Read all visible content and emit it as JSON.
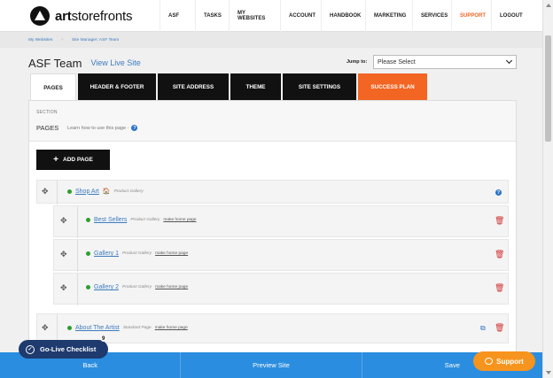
{
  "nav": {
    "brand_bold": "art",
    "brand_light": "storefronts",
    "items": [
      {
        "label": "ASF"
      },
      {
        "label": "TASKS"
      },
      {
        "label": "MY WEBSITES"
      },
      {
        "label": "ACCOUNT"
      },
      {
        "label": "HANDBOOK"
      },
      {
        "label": "MARKETING"
      },
      {
        "label": "SERVICES"
      },
      {
        "label": "SUPPORT"
      },
      {
        "label": "LOGOUT"
      }
    ]
  },
  "breadcrumb": {
    "items": [
      "My Websites",
      "Site Manager: ASF Team"
    ],
    "separator": "›"
  },
  "header": {
    "title": "ASF Team",
    "view_live": "View Live Site",
    "jump_label": "Jump to:",
    "jump_value": "Please Select"
  },
  "tabs": [
    {
      "label": "PAGES"
    },
    {
      "label": "HEADER & FOOTER"
    },
    {
      "label": "SITE ADDRESS"
    },
    {
      "label": "THEME"
    },
    {
      "label": "SITE SETTINGS"
    },
    {
      "label": "SUCCESS PLAN"
    }
  ],
  "section": {
    "label": "SECTION",
    "name": "PAGES",
    "help_text": "Learn how to use this page -",
    "help_icon": "?"
  },
  "add_page": {
    "label": "ADD PAGE",
    "icon": "+"
  },
  "pages": [
    {
      "title": "Shop Art",
      "type": "Product Gallery",
      "home": "",
      "is_home": true
    },
    {
      "title": "Best Sellers",
      "type": "Product Gallery",
      "home": "make home page"
    },
    {
      "title": "Gallery 1",
      "type": "Product Gallery",
      "home": "make home page"
    },
    {
      "title": "Gallery 2",
      "type": "Product Gallery",
      "home": "make home page"
    },
    {
      "title": "About The Artist",
      "type": "Standard Page",
      "home": "make home page"
    }
  ],
  "bottom": {
    "back": "Back",
    "preview": "Preview Site",
    "save": "Save"
  },
  "golive": {
    "label": "Go-Live Checklist",
    "count": "9"
  },
  "support": {
    "label": "Support"
  },
  "colors": {
    "accent": "#f26522",
    "link": "#3b7bbf",
    "bottom_bar": "#2b8ddf",
    "golive": "#1e3a6e",
    "support": "#f7941d"
  }
}
